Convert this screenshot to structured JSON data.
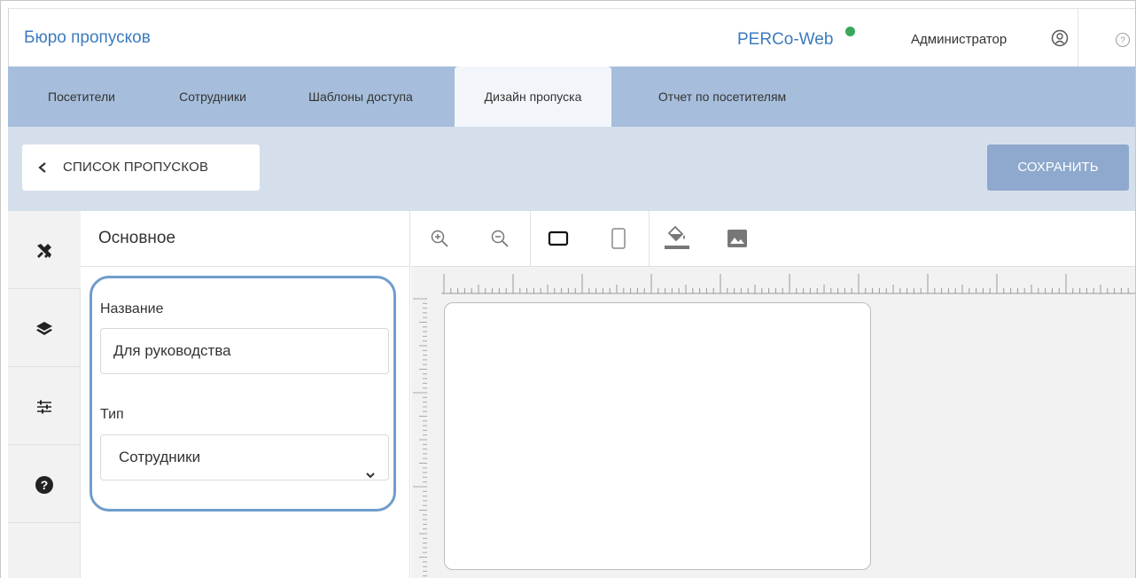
{
  "header": {
    "app_title": "Бюро пропусков",
    "brand": "PERCo-Web",
    "user": "Администратор"
  },
  "tabs": [
    {
      "label": "Посетители",
      "active": false
    },
    {
      "label": "Сотрудники",
      "active": false
    },
    {
      "label": "Шаблоны доступа",
      "active": false
    },
    {
      "label": "Дизайн пропуска",
      "active": true
    },
    {
      "label": "Отчет по посетителям",
      "active": false
    }
  ],
  "toolbar": {
    "back_label": "СПИСОК ПРОПУСКОВ",
    "save_label": "СОХРАНИТЬ"
  },
  "leftnav": {
    "items": [
      "tools-icon",
      "layers-icon",
      "sliders-icon",
      "help-circle-icon"
    ]
  },
  "panel": {
    "title": "Основное",
    "name_label": "Название",
    "name_value": "Для руководства",
    "type_label": "Тип",
    "type_value": "Сотрудники"
  },
  "canvas_tools": [
    "zoom-in-icon",
    "zoom-out-icon",
    "landscape-icon",
    "portrait-icon",
    "fill-color-icon",
    "image-icon"
  ],
  "colors": {
    "accent": "#3c7bbd",
    "tabs_bg": "#a6bedb",
    "bar_bg": "#d5dfec",
    "save_btn": "#8ea9cd",
    "highlight": "#6f9dcb",
    "status_online": "#39a85c"
  }
}
